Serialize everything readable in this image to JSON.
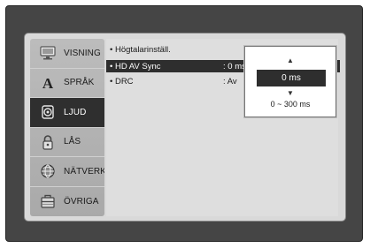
{
  "sidebar": {
    "items": [
      {
        "label": "VISNING",
        "icon": "display-icon"
      },
      {
        "label": "SPRÅK",
        "icon": "language-a-icon"
      },
      {
        "label": "LJUD",
        "icon": "speaker-icon",
        "active": true
      },
      {
        "label": "LÅS",
        "icon": "lock-icon"
      },
      {
        "label": "NÄTVERK",
        "icon": "network-globe-icon"
      },
      {
        "label": "ÖVRIGA",
        "icon": "toolbox-icon"
      }
    ]
  },
  "settings": [
    {
      "label": "• Högtalarinställ.",
      "value": ""
    },
    {
      "label": "• HD AV Sync",
      "value": ": 0 ms"
    },
    {
      "label": "• DRC",
      "value": ": Av"
    }
  ],
  "popup": {
    "up_arrow": "▲",
    "value": "0 ms",
    "down_arrow": "▼",
    "range": "0 ~ 300 ms"
  }
}
